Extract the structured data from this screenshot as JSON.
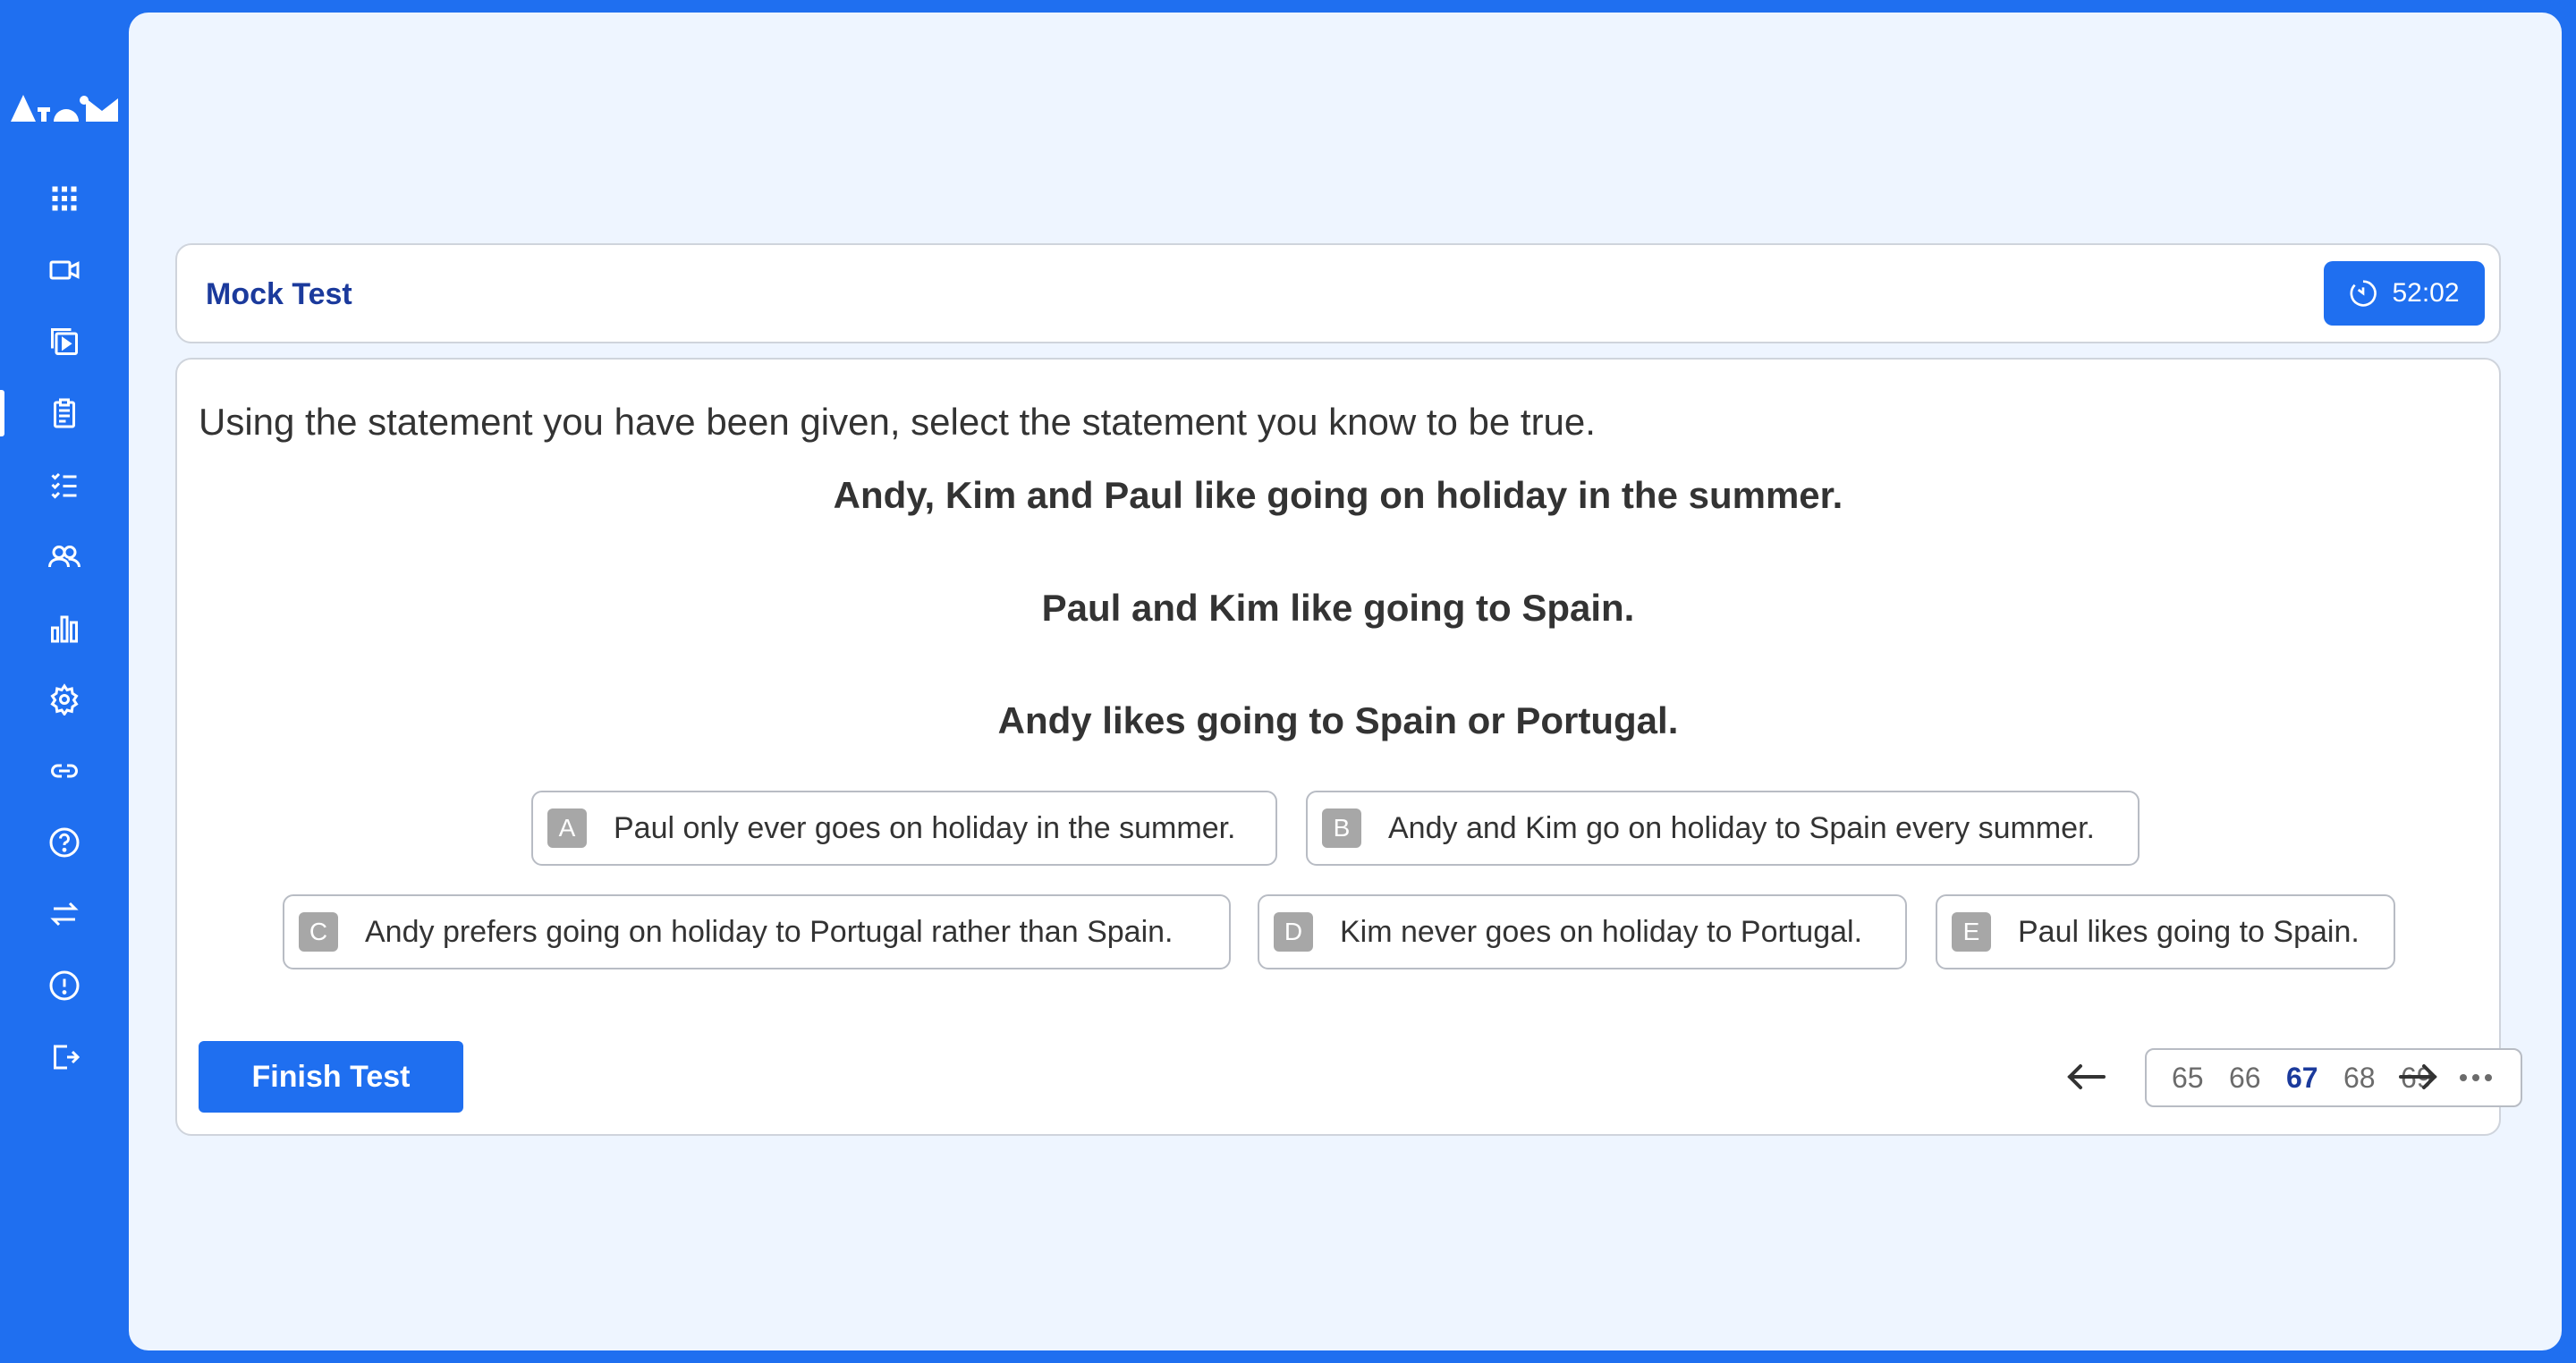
{
  "sidebar": {
    "logo_text": "atom",
    "items": [
      {
        "icon": "grid-icon",
        "name": "dashboard"
      },
      {
        "icon": "video-icon",
        "name": "videos"
      },
      {
        "icon": "playlist-icon",
        "name": "courses"
      },
      {
        "icon": "clipboard-icon",
        "name": "tests",
        "active": true
      },
      {
        "icon": "checklist-icon",
        "name": "tasks"
      },
      {
        "icon": "users-icon",
        "name": "users"
      },
      {
        "icon": "bar-chart-icon",
        "name": "reports"
      },
      {
        "icon": "gear-icon",
        "name": "settings"
      },
      {
        "icon": "link-icon",
        "name": "links"
      },
      {
        "icon": "help-icon",
        "name": "help"
      },
      {
        "icon": "swap-icon",
        "name": "switch"
      },
      {
        "icon": "alert-icon",
        "name": "alerts"
      },
      {
        "icon": "logout-icon",
        "name": "logout"
      }
    ]
  },
  "header": {
    "title": "Mock Test",
    "timer": "52:02"
  },
  "question": {
    "prompt": "Using the statement you have been given, select the statement you know to be true.",
    "statements": [
      "Andy, Kim and Paul like going on holiday in the summer.",
      "Paul and Kim like going to Spain.",
      "Andy likes going to Spain or Portugal."
    ],
    "options": [
      {
        "letter": "A",
        "text": "Paul only ever goes on holiday in the summer."
      },
      {
        "letter": "B",
        "text": "Andy and Kim go on holiday to Spain every summer."
      },
      {
        "letter": "C",
        "text": "Andy prefers going on holiday to Portugal rather than Spain."
      },
      {
        "letter": "D",
        "text": "Kim never goes on holiday to Portugal."
      },
      {
        "letter": "E",
        "text": "Paul likes going to Spain."
      }
    ]
  },
  "footer": {
    "finish_label": "Finish Test",
    "pages": [
      "65",
      "66",
      "67",
      "68",
      "69"
    ],
    "current_page": "67"
  },
  "colors": {
    "accent": "#1f6ff0",
    "title": "#1b3a9c",
    "panel_bg": "#eef5ff"
  }
}
